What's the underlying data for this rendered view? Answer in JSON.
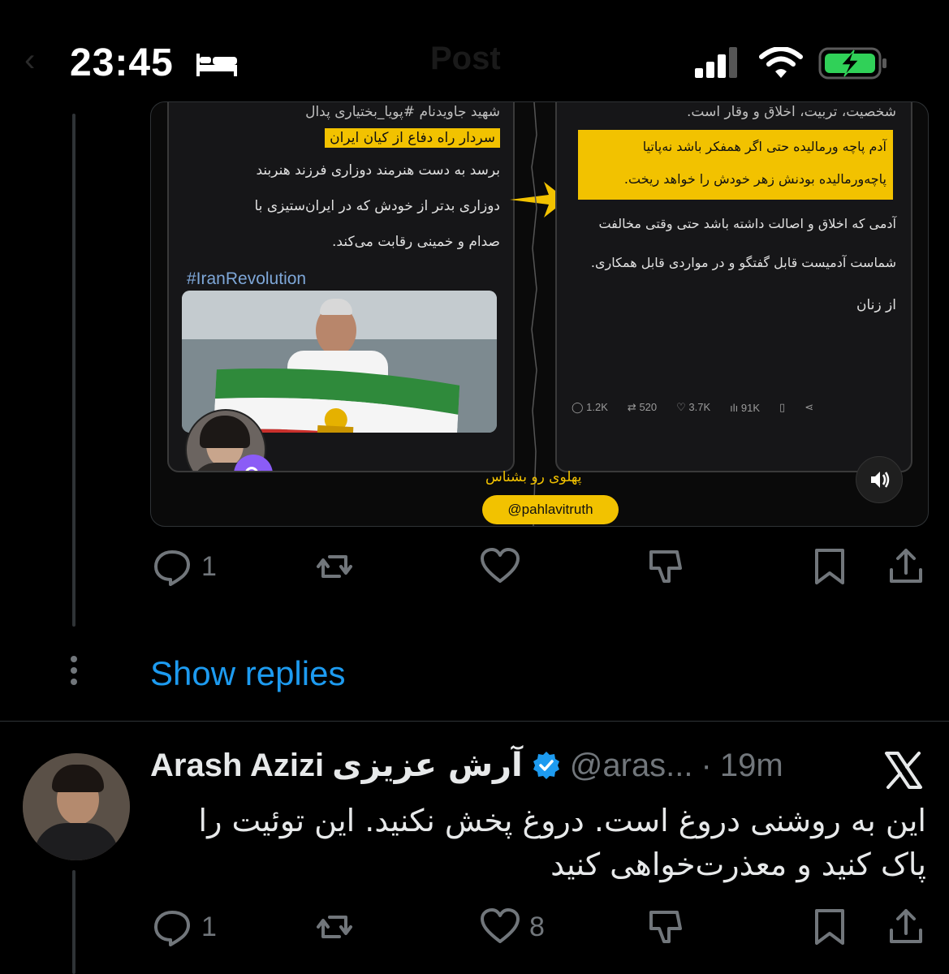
{
  "status_bar": {
    "time": "23:45",
    "header_title": "Post"
  },
  "embedded_media": {
    "left_shot": {
      "line1": "شهید جاویدنام #پویا_بختیاری پدال",
      "line2": "سردار راه دفاع از کیان ایران",
      "line3": "برسد به دست هنرمند دوزاری فرزند هنربند",
      "line4": "دوزاری بدتر از خودش که در ایران‌ستیزی با",
      "line5": "صدام و خمینی رقابت می‌کند.",
      "hashtag": "#IranRevolution"
    },
    "right_shot": {
      "line1": "شخصیت، تربیت، اخلاق و وقار است.",
      "line2": "آدم پاچه ورمالیده حتی اگر همفکر باشد نه‌پاتیا",
      "line3": "پاچه‌ورمالیده بودنش زهر خودش را خواهد ریخت.",
      "line4": "آدمی که اخلاق و اصالت داشته باشد حتی وقتی مخالفت",
      "line5": "شماست آدمیست قابل گفتگو و در مواردی قابل همکاری.",
      "line6": "از زنان",
      "stats": {
        "replies": "1.2K",
        "reposts": "520",
        "likes": "3.7K",
        "views": "91K"
      }
    },
    "watermark_title": "پهلوی رو بشناس",
    "watermark_handle": "@pahlavitruth"
  },
  "tweet1_actions": {
    "reply_count": "1",
    "repost_count": "",
    "like_count": ""
  },
  "show_replies_label": "Show replies",
  "tweet2": {
    "name": "Arash Azizi",
    "name_fa": "آرش عزیزی",
    "handle": "@aras...",
    "separator": "·",
    "time": "19m",
    "text": "این به روشنی دروغ است. دروغ پخش نکنید. این توئیت را پاک کنید و معذرت‌خواهی کنید",
    "reply_count": "1",
    "like_count": "8"
  },
  "colors": {
    "background": "#000000",
    "accent": "#1d9bf0",
    "muted": "#71767b",
    "highlight": "#f2c200"
  }
}
